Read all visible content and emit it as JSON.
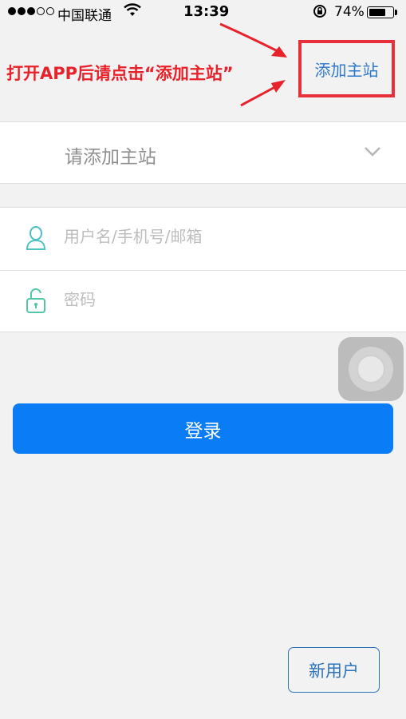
{
  "status_bar": {
    "carrier": "中国联通",
    "time": "13:39",
    "battery": "74%",
    "battery_level": 0.74,
    "signal_bars_filled": 3,
    "signal_bars_total": 5
  },
  "annotation": {
    "text": "打开APP后请点击“添加主站”",
    "color": "#e8222a"
  },
  "header": {
    "add_site_label": "添加主站",
    "highlight_color": "#e8303a"
  },
  "site_select": {
    "placeholder": "请添加主站",
    "icon": "chevron-down-icon"
  },
  "form": {
    "username_placeholder": "用户名/手机号/邮箱",
    "username_icon": "user-icon",
    "password_placeholder": "密码",
    "password_icon": "unlock-icon"
  },
  "login_button": {
    "label": "登录",
    "color": "#0a7cf6"
  },
  "new_user_button": {
    "label": "新用户"
  }
}
